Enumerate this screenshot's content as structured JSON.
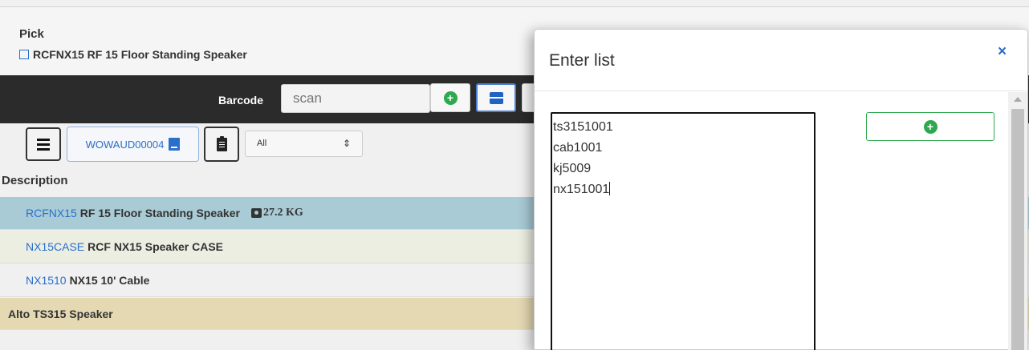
{
  "pick": {
    "title": "Pick",
    "item": "RCFNX15 RF 15 Floor Standing Speaker"
  },
  "toolbar": {
    "barcode_label": "Barcode",
    "scan_placeholder": "scan"
  },
  "list_bar": {
    "order_code": "WOWAUD00004",
    "filter_value": "All"
  },
  "table": {
    "header": "Description",
    "rows": [
      {
        "code": "RCFNX15",
        "name": "RF 15 Floor Standing Speaker",
        "weight": "27.2 KG"
      },
      {
        "code": "NX15CASE",
        "name": "RCF NX15 Speaker CASE"
      },
      {
        "code": "NX1510",
        "name": "NX15 10' Cable"
      },
      {
        "code": "",
        "name": "Alto TS315 Speaker"
      }
    ]
  },
  "modal": {
    "title": "Enter list",
    "close_symbol": "×",
    "list_lines": [
      "ts3151001",
      "cab1001",
      "kj5009",
      "nx151001"
    ]
  },
  "colors": {
    "accent_blue": "#2a6fc9",
    "add_green": "#2fa84f",
    "toolbar_dark": "#2b2b2b",
    "row_selected": "#a9cbd6",
    "row_yellow": "#e5d9b4"
  }
}
